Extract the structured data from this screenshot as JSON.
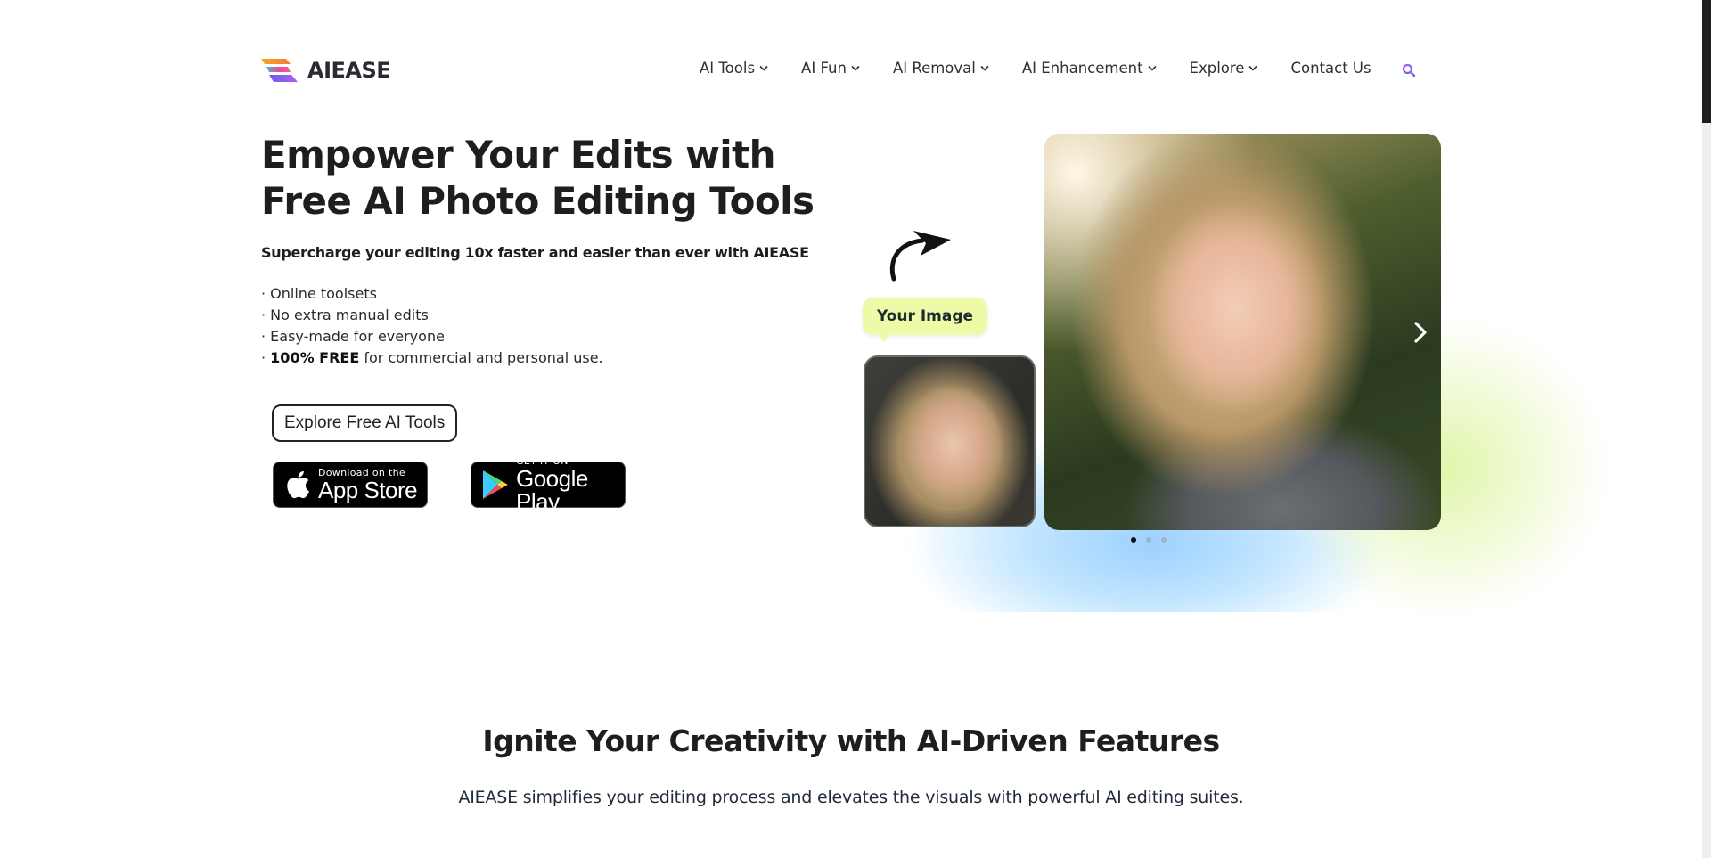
{
  "brand": {
    "name": "AIEASE",
    "accent_search": "#7b5cf0",
    "gradient_colors": [
      "#f5a623",
      "#e94e9a",
      "#6a5cf0",
      "#3fb8e8"
    ]
  },
  "nav": {
    "items": [
      {
        "label": "AI Tools",
        "has_dropdown": true
      },
      {
        "label": "AI Fun",
        "has_dropdown": true
      },
      {
        "label": "AI Removal",
        "has_dropdown": true
      },
      {
        "label": "AI Enhancement",
        "has_dropdown": true
      },
      {
        "label": "Explore",
        "has_dropdown": true
      },
      {
        "label": "Contact Us",
        "has_dropdown": false
      }
    ],
    "search_icon": "search-icon"
  },
  "hero": {
    "title": "Empower Your Edits with Free AI Photo Editing Tools",
    "subtitle": "Supercharge your editing 10x faster and easier than ever with AIEASE",
    "bullets": [
      {
        "prefix": "· ",
        "bold": "",
        "text": "Online toolsets"
      },
      {
        "prefix": "· ",
        "bold": "",
        "text": "No extra manual edits"
      },
      {
        "prefix": "· ",
        "bold": "",
        "text": "Easy-made for everyone"
      },
      {
        "prefix": "· ",
        "bold": "100% FREE",
        "text": " for commercial and personal use."
      }
    ],
    "cta_label": "Explore Free AI Tools",
    "app_store": {
      "small": "Download on the",
      "big": "App Store"
    },
    "google_play": {
      "small": "GET IT ON",
      "big": "Google Play"
    }
  },
  "showcase": {
    "tag_label": "Your Image",
    "before_image_alt": "Selfie of a smiling woman with wavy blonde hair",
    "after_image_alt": "Professional headshot of a woman in a grey blazer",
    "slides_total": 3,
    "active_slide": 1
  },
  "features": {
    "title": "Ignite Your Creativity with AI-Driven Features",
    "subtitle": "AIEASE simplifies your editing process and elevates the visuals with powerful AI editing suites."
  }
}
